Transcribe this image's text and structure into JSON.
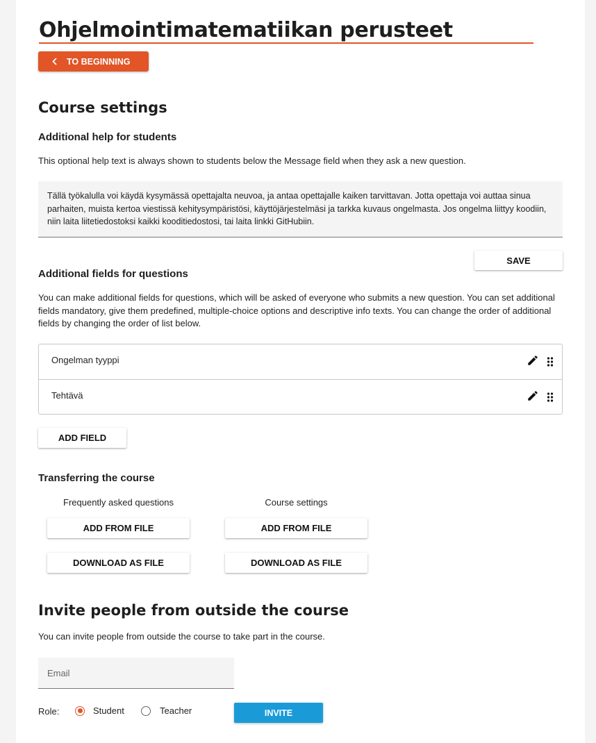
{
  "page": {
    "title": "Ohjelmointimatematiikan perusteet",
    "back_button_label": "TO BEGINNING"
  },
  "course_settings": {
    "heading": "Course settings",
    "help": {
      "heading": "Additional help for students",
      "description": "This optional help text is always shown to students below the Message field when they ask a new question.",
      "text_value": "Tällä työkalulla voi käydä kysymässä opettajalta neuvoa, ja antaa opettajalle kaiken tarvittavan. Jotta opettaja voi auttaa sinua parhaiten, muista kertoa viestissä kehitysympäristösi, käyttöjärjestelmäsi ja tarkka kuvaus ongelmasta. Jos ongelma liittyy koodiin, niin laita liitetiedostoksi kaikki kooditiedostosi, tai laita linkki GitHubiin.",
      "save_label": "SAVE"
    },
    "fields": {
      "heading": "Additional fields for questions",
      "description": "You can make additional fields for questions, which will be asked of everyone who submits a new question. You can set additional fields mandatory, give them predefined, multiple-choice options and descriptive info texts. You can change the order of additional fields by changing the order of list below.",
      "items": [
        {
          "label": "Ongelman tyyppi"
        },
        {
          "label": "Tehtävä"
        }
      ],
      "add_label": "ADD FIELD"
    },
    "transfer": {
      "heading": "Transferring the course",
      "columns": [
        {
          "label": "Frequently asked questions",
          "add_label": "ADD FROM FILE",
          "download_label": "DOWNLOAD AS FILE"
        },
        {
          "label": "Course settings",
          "add_label": "ADD FROM FILE",
          "download_label": "DOWNLOAD AS FILE"
        }
      ]
    }
  },
  "invite": {
    "heading": "Invite people from outside the course",
    "description": "You can invite people from outside the course to take part in the course.",
    "email_placeholder": "Email",
    "email_value": "",
    "role_label": "Role:",
    "roles": [
      {
        "label": "Student",
        "selected": true
      },
      {
        "label": "Teacher",
        "selected": false
      }
    ],
    "invite_label": "INVITE"
  },
  "colors": {
    "accent": "#e15527",
    "invite_button": "#1a9bd8",
    "background": "#f4f4f4"
  }
}
